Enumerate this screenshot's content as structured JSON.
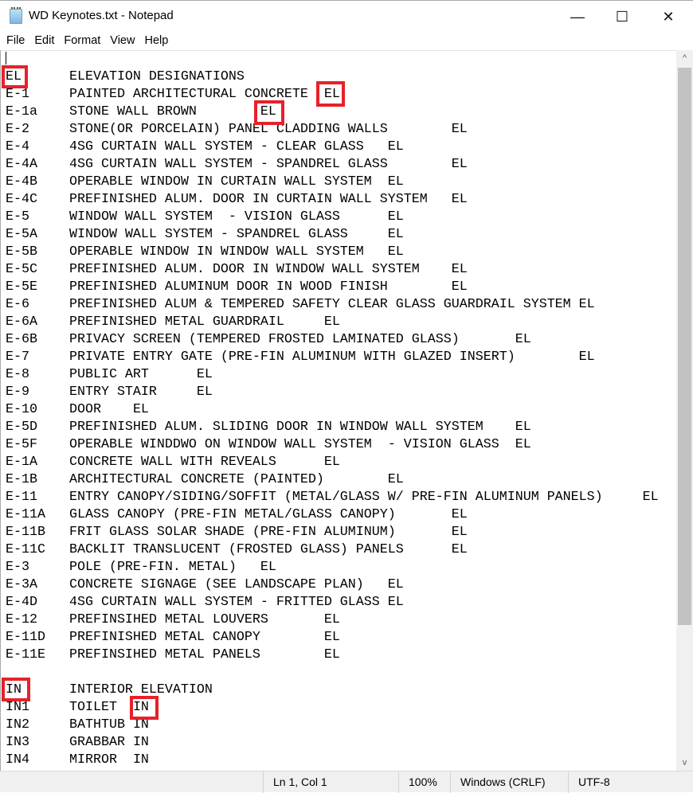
{
  "window": {
    "title": "WD Keynotes.txt - Notepad",
    "minimize": "—",
    "maximize": "☐",
    "close": "✕"
  },
  "menu": [
    "File",
    "Edit",
    "Format",
    "View",
    "Help"
  ],
  "document": {
    "lines": [
      "",
      "EL\tELEVATION DESIGNATIONS",
      "E-1\tPAINTED ARCHITECTURAL CONCRETE\tEL",
      "E-1a\tSTONE WALL BROWN\tEL",
      "E-2\tSTONE(OR PORCELAIN) PANEL CLADDING WALLS\tEL",
      "E-4\t4SG CURTAIN WALL SYSTEM - CLEAR GLASS\tEL",
      "E-4A\t4SG CURTAIN WALL SYSTEM - SPANDREL GLASS\tEL",
      "E-4B\tOPERABLE WINDOW IN CURTAIN WALL SYSTEM\tEL",
      "E-4C\tPREFINISHED ALUM. DOOR IN CURTAIN WALL SYSTEM\tEL",
      "E-5\tWINDOW WALL SYSTEM  - VISION GLASS\tEL",
      "E-5A\tWINDOW WALL SYSTEM - SPANDREL GLASS\tEL",
      "E-5B\tOPERABLE WINDOW IN WINDOW WALL SYSTEM\tEL",
      "E-5C\tPREFINISHED ALUM. DOOR IN WINDOW WALL SYSTEM\tEL",
      "E-5E\tPREFINISHED ALUMINUM DOOR IN WOOD FINISH\tEL",
      "E-6\tPREFINISHED ALUM & TEMPERED SAFETY CLEAR GLASS GUARDRAIL SYSTEM EL",
      "E-6A\tPREFINISHED METAL GUARDRAIL\tEL",
      "E-6B\tPRIVACY SCREEN (TEMPERED FROSTED LAMINATED GLASS)\tEL",
      "E-7\tPRIVATE ENTRY GATE (PRE-FIN ALUMINUM WITH GLAZED INSERT)\tEL",
      "E-8\tPUBLIC ART\tEL",
      "E-9\tENTRY STAIR\tEL",
      "E-10\tDOOR\tEL",
      "E-5D\tPREFINISHED ALUM. SLIDING DOOR IN WINDOW WALL SYSTEM\tEL",
      "E-5F\tOPERABLE WINDDWO ON WINDOW WALL SYSTEM  - VISION GLASS  EL",
      "E-1A\tCONCRETE WALL WITH REVEALS\tEL",
      "E-1B\tARCHITECTURAL CONCRETE (PAINTED)\tEL",
      "E-11\tENTRY CANOPY/SIDING/SOFFIT (METAL/GLASS W/ PRE-FIN ALUMINUM PANELS)\tEL",
      "E-11A\tGLASS CANOPY (PRE-FIN METAL/GLASS CANOPY)\tEL",
      "E-11B\tFRIT GLASS SOLAR SHADE (PRE-FIN ALUMINUM)\tEL",
      "E-11C\tBACKLIT TRANSLUCENT (FROSTED GLASS) PANELS\tEL",
      "E-3\tPOLE (PRE-FIN. METAL)\tEL",
      "E-3A\tCONCRETE SIGNAGE (SEE LANDSCAPE PLAN)\tEL",
      "E-4D\t4SG CURTAIN WALL SYSTEM - FRITTED GLASS EL",
      "E-12\tPREFINSIHED METAL LOUVERS\tEL",
      "E-11D\tPREFINISHED METAL CANOPY\tEL",
      "E-11E\tPREFINSIHED METAL PANELS\tEL",
      "",
      "IN\tINTERIOR ELEVATION",
      "IN1\tTOILET\tIN",
      "IN2\tBATHTUB\tIN",
      "IN3\tGRABBAR\tIN",
      "IN4\tMIRROR\tIN"
    ]
  },
  "highlight_color": "#e8202a",
  "status": {
    "position": "Ln 1, Col 1",
    "zoom": "100%",
    "line_endings": "Windows (CRLF)",
    "encoding": "UTF-8"
  }
}
